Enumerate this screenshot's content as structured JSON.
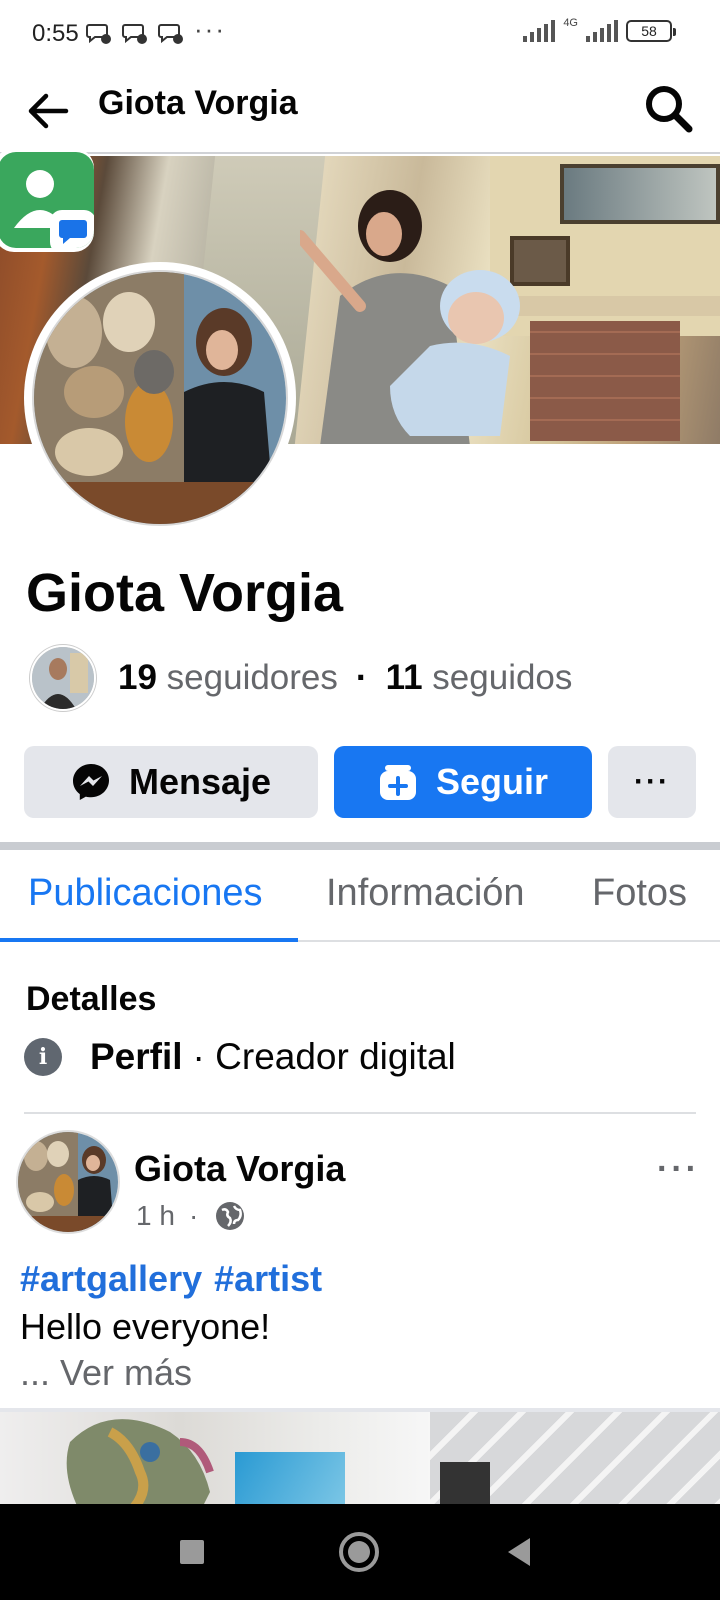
{
  "status_bar": {
    "time": "0:55",
    "more": "···",
    "network": "4G",
    "battery": "58"
  },
  "header": {
    "title": "Giota Vorgia"
  },
  "profile": {
    "name": "Giota Vorgia",
    "followers_count": "19",
    "followers_label": "seguidores",
    "following_count": "11",
    "following_label": "seguidos",
    "separator": "·"
  },
  "actions": {
    "message_label": "Mensaje",
    "follow_label": "Seguir",
    "more_label": "···"
  },
  "tabs": [
    {
      "label": "Publicaciones",
      "active": true
    },
    {
      "label": "Información",
      "active": false
    },
    {
      "label": "Fotos",
      "active": false
    }
  ],
  "details": {
    "title": "Detalles",
    "type_label": "Perfil",
    "type_value": "· Creador digital"
  },
  "post": {
    "author": "Giota Vorgia",
    "time": "1 h",
    "dot": "·",
    "hashtags": [
      "#artgallery",
      "#artist"
    ],
    "text": "Hello everyone!",
    "see_more": "... Ver más",
    "options": "···"
  },
  "colors": {
    "accent": "#1877f2",
    "link": "#216fdb",
    "secondary_text": "#65676b",
    "button_gray": "#e4e6eb"
  },
  "icons": {
    "back": "arrow-left-icon",
    "search": "search-icon",
    "messenger": "messenger-icon",
    "follow": "follow-add-icon",
    "info": "info-icon",
    "privacy": "globe-icon"
  }
}
